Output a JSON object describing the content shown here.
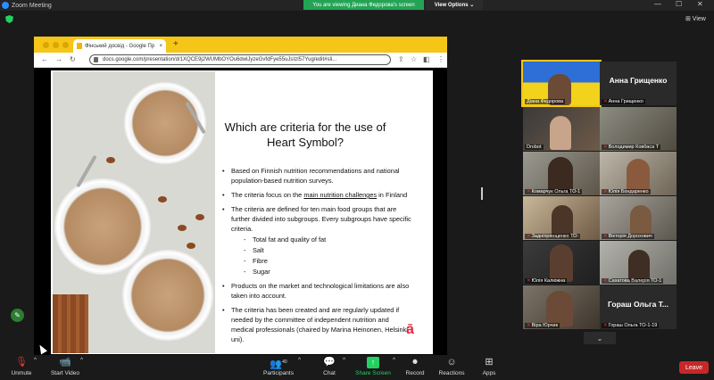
{
  "window": {
    "title": "Zoom Meeting",
    "minimize": "—",
    "maximize": "☐",
    "close": "✕"
  },
  "share_banner": {
    "text": "You are viewing Диана Федорова's screen"
  },
  "view_options": {
    "label": "View Options",
    "caret": "⌄"
  },
  "gallery_view": {
    "label": "⊞ View"
  },
  "browser": {
    "tab_title": "Фінський досвід - Google Пр",
    "tab_close": "×",
    "new_tab": "+",
    "url": "docs.google.com/presentation/d/1XQCE9j2WUMbOYOu6dwlJyzeGvfdFye55uJsIzI57Yug/edit#sli...",
    "nav": {
      "back": "←",
      "forward": "→",
      "reload": "↻",
      "menu": "⋮"
    }
  },
  "slide": {
    "title_line1": "Which are criteria for the use of",
    "title_line2": "Heart Symbol?",
    "bullets": {
      "b1": "Based on Finnish nutrition recommendations and national population-based nutrition surveys.",
      "b2_pre": "The criteria focus on the ",
      "b2_link": "main nutrition challenges",
      "b2_post": " in Finland",
      "b3": "The criteria are defined for ten main food groups that are further divided into subgroups. Every subgroups have specific criteria.",
      "sub1": "Total fat and quality of fat",
      "sub2": "Salt",
      "sub3": "Fibre",
      "sub4": "Sugar",
      "b4": "Products on the market and technological limitations are also taken into account.",
      "b5": "The criteria has been created and are regularly updated if needed by the committee of independent nutrition and medical professionals (chaired by Marina Heinonen, Helsinki uni)."
    },
    "logo": "ā"
  },
  "participants": [
    {
      "name": "Діана Федорова",
      "bigname": ""
    },
    {
      "name": "Анна Грищенко",
      "bigname": "Анна Грищенко"
    },
    {
      "name": "Drobot",
      "bigname": ""
    },
    {
      "name": "Володимир Ковбаса Т",
      "bigname": ""
    },
    {
      "name": "Комарчук Ольга ТО-1",
      "bigname": ""
    },
    {
      "name": "Юлія Бондаренко",
      "bigname": ""
    },
    {
      "name": "Задніпрянщенко ТО-",
      "bigname": ""
    },
    {
      "name": "Вікторія Дорохович",
      "bigname": ""
    },
    {
      "name": "Юлія Калюжна",
      "bigname": ""
    },
    {
      "name": "Сахатова Валерія ТО-1",
      "bigname": ""
    },
    {
      "name": "Віра Юрчик",
      "bigname": ""
    },
    {
      "name": "Гораш Ольга ТО-1-19",
      "bigname": "Гораш Ольга Т..."
    }
  ],
  "mic_off_symbol": "✕",
  "scroll_down": "⌄",
  "pencil": "✎",
  "toolbar": {
    "unmute": "Unmute",
    "start_video": "Start Video",
    "participants": "Participants",
    "participants_count": "40",
    "chat": "Chat",
    "share_screen": "Share Screen",
    "record": "Record",
    "reactions": "Reactions",
    "apps": "Apps",
    "leave": "Leave",
    "caret": "^"
  }
}
